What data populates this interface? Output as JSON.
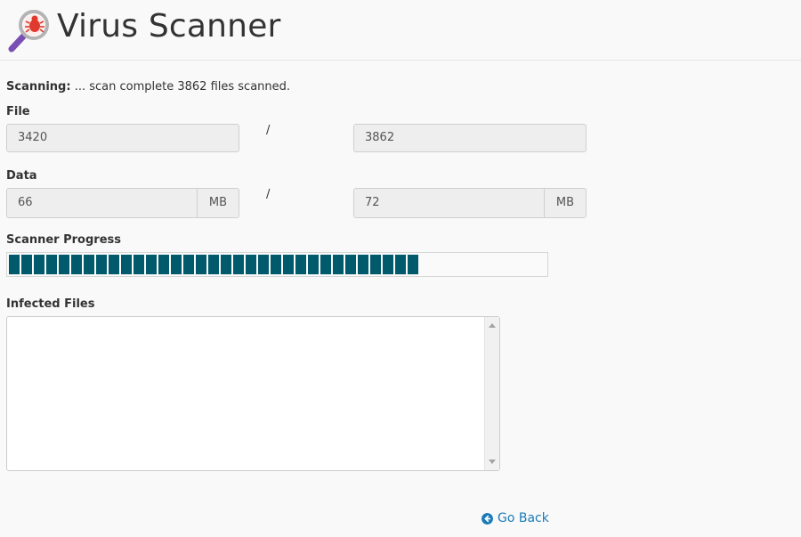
{
  "header": {
    "title": "Virus Scanner",
    "logo_icon": "magnifier-bug-icon"
  },
  "scan": {
    "label": "Scanning:",
    "status": " ... scan complete 3862 files scanned."
  },
  "file": {
    "label": "File",
    "scanned": "3420",
    "separator": "/",
    "total": "3862"
  },
  "data": {
    "label": "Data",
    "scanned": "66",
    "scanned_unit": "MB",
    "separator": "/",
    "total": "72",
    "total_unit": "MB"
  },
  "progress": {
    "label": "Scanner Progress",
    "fraction": 0.786,
    "color": "#005a6b"
  },
  "infected": {
    "label": "Infected Files",
    "value": ""
  },
  "footer": {
    "go_back": "Go Back",
    "go_back_icon": "arrow-circle-left-icon"
  },
  "colors": {
    "link": "#1a7bb9",
    "progress": "#005a6b"
  }
}
